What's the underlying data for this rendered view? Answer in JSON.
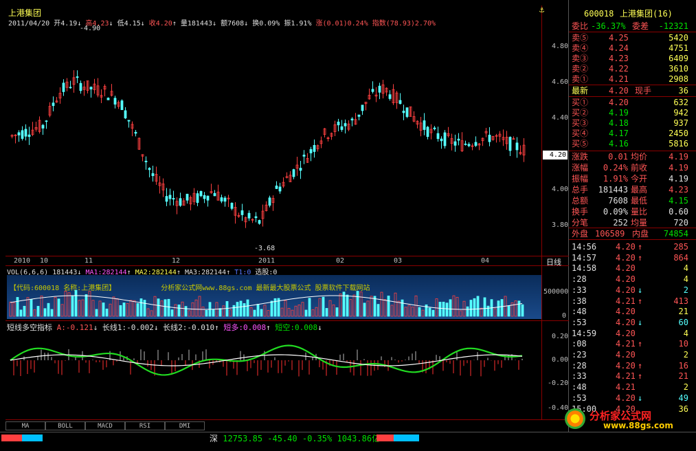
{
  "chart_header": {
    "title": "上港集团",
    "date": "2011/04/20",
    "open_label": "开",
    "open": "4.19",
    "high_label": "高",
    "high": "4.23",
    "low_label": "低",
    "low": "4.15",
    "close_label": "收",
    "close": "4.20",
    "vol_label": "量",
    "vol": "181443",
    "amt_label": "额",
    "amt": "7608",
    "turn_label": "换",
    "turn": "0.09%",
    "amp_label": "振",
    "amp": "1.91%",
    "chg_label": "涨",
    "chg": "(0.01)0.24%",
    "idx_label": "指数",
    "idx": "(78.93)2.70%"
  },
  "price_axis": [
    "4.80",
    "4.60",
    "4.40",
    "4.20",
    "4.00",
    "3.80"
  ],
  "current_price_tag": "4.20",
  "high_marker": "4.90",
  "low_marker": "3.68",
  "date_axis": [
    "2010",
    "10",
    "11",
    "12",
    "2011",
    "02",
    "03",
    "04"
  ],
  "period_label": "日线",
  "vol_header": {
    "name": "VOL(6,6,6)",
    "vol": "181443",
    "ma1": "MA1:282144",
    "ma2": "MA2:282144",
    "ma3": "MA3:282144",
    "t1": "T1:0",
    "pick": "选股:0"
  },
  "vol_axis": [
    "500000",
    "0"
  ],
  "banner": {
    "code": "【代码:600018",
    "name": "名称:上港集团】",
    "ad": "分析家公式网www.88gs.com 最新最大股票公式  股票软件下载网站"
  },
  "ind_header": {
    "name": "短线多空指标",
    "a": "A:-0.121",
    "l1": "长线1:-0.002",
    "l2": "长线2:-0.010",
    "dd": "短多:0.008",
    "dk": "短空:0.008"
  },
  "ind_axis": [
    "0.20",
    "0.00",
    "-0.20",
    "-0.40"
  ],
  "tabs": [
    "MA",
    "BOLL",
    "MACD",
    "RSI",
    "DMI"
  ],
  "status_bar": {
    "market": "深",
    "index": "12753.85",
    "change": "-45.40",
    "pct": "-0.35%",
    "amount": "1043.86亿"
  },
  "quote": {
    "code": "600018",
    "name": "上港集团(16)",
    "weibi_label": "委比",
    "weibi": "-36.37%",
    "weicha_label": "委差",
    "weicha": "-12321",
    "sells": [
      {
        "label": "卖⑤",
        "price": "4.25",
        "vol": "5420"
      },
      {
        "label": "卖④",
        "price": "4.24",
        "vol": "4751"
      },
      {
        "label": "卖③",
        "price": "4.23",
        "vol": "6409"
      },
      {
        "label": "卖②",
        "price": "4.22",
        "vol": "3610"
      },
      {
        "label": "卖①",
        "price": "4.21",
        "vol": "2908"
      }
    ],
    "last_label": "最新",
    "last": "4.20",
    "cur_label": "现手",
    "cur": "36",
    "buys": [
      {
        "label": "买①",
        "price": "4.20",
        "vol": "632"
      },
      {
        "label": "买②",
        "price": "4.19",
        "vol": "942"
      },
      {
        "label": "买③",
        "price": "4.18",
        "vol": "937"
      },
      {
        "label": "买④",
        "price": "4.17",
        "vol": "2450"
      },
      {
        "label": "买⑤",
        "price": "4.16",
        "vol": "5816"
      }
    ],
    "stats": [
      {
        "l1": "涨跌",
        "v1": "0.01",
        "l2": "均价",
        "v2": "4.19"
      },
      {
        "l1": "涨幅",
        "v1": "0.24%",
        "l2": "前收",
        "v2": "4.19"
      },
      {
        "l1": "振幅",
        "v1": "1.91%",
        "l2": "今开",
        "v2": "4.19"
      },
      {
        "l1": "总手",
        "v1": "181443",
        "l2": "最高",
        "v2": "4.23"
      },
      {
        "l1": "总额",
        "v1": "7608",
        "l2": "最低",
        "v2": "4.15"
      },
      {
        "l1": "换手",
        "v1": "0.09%",
        "l2": "量比",
        "v2": "0.60"
      },
      {
        "l1": "分笔",
        "v1": "252",
        "l2": "均量",
        "v2": "720"
      }
    ],
    "outer_label": "外盘",
    "outer": "106589",
    "inner_label": "内盘",
    "inner": "74854"
  },
  "ticks": [
    {
      "time": "14:56",
      "price": "4.20",
      "arrow": "↑",
      "vol": "285"
    },
    {
      "time": "14:57",
      "price": "4.20",
      "arrow": "↑",
      "vol": "864"
    },
    {
      "time": "14:58",
      "price": "4.20",
      "arrow": "",
      "vol": "4"
    },
    {
      "time": ":28",
      "price": "4.20",
      "arrow": "",
      "vol": "4"
    },
    {
      "time": ":33",
      "price": "4.20",
      "arrow": "↓",
      "vol": "2"
    },
    {
      "time": ":38",
      "price": "4.21",
      "arrow": "↑",
      "vol": "413"
    },
    {
      "time": ":48",
      "price": "4.20",
      "arrow": "",
      "vol": "21"
    },
    {
      "time": ":53",
      "price": "4.20",
      "arrow": "↓",
      "vol": "60"
    },
    {
      "time": "14:59",
      "price": "4.20",
      "arrow": "",
      "vol": "4"
    },
    {
      "time": ":08",
      "price": "4.21",
      "arrow": "↑",
      "vol": "10"
    },
    {
      "time": ":23",
      "price": "4.20",
      "arrow": "",
      "vol": "2"
    },
    {
      "time": ":28",
      "price": "4.20",
      "arrow": "↑",
      "vol": "16"
    },
    {
      "time": ":33",
      "price": "4.21",
      "arrow": "↑",
      "vol": "21"
    },
    {
      "time": ":48",
      "price": "4.21",
      "arrow": "",
      "vol": "2"
    },
    {
      "time": ":53",
      "price": "4.20",
      "arrow": "↓",
      "vol": "49"
    },
    {
      "time": "15:00",
      "price": "4.20",
      "arrow": "",
      "vol": "36"
    }
  ],
  "watermark": {
    "brand": "分析家公式网",
    "url": "www.88gs.com"
  },
  "colors": {
    "up": "#ff5555",
    "down": "#55ffff",
    "grid": "#8b0000",
    "short_line": "#22dd22"
  }
}
